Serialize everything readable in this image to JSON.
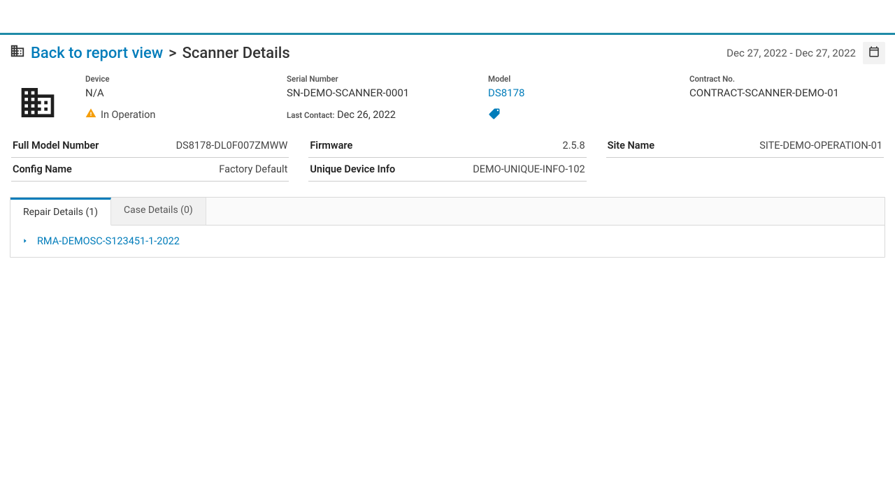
{
  "header": {
    "back_label": "Back to report view",
    "separator": ">",
    "page_title": "Scanner Details",
    "date_range": "Dec 27, 2022 - Dec 27, 2022"
  },
  "summary": {
    "device": {
      "label": "Device",
      "value": "N/A"
    },
    "status_text": "In Operation",
    "serial": {
      "label": "Serial Number",
      "value": "SN-DEMO-SCANNER-0001"
    },
    "last_contact": {
      "label": "Last Contact:",
      "value": "Dec 26, 2022"
    },
    "model": {
      "label": "Model",
      "value": "DS8178"
    },
    "contract": {
      "label": "Contract No.",
      "value": "CONTRACT-SCANNER-DEMO-01"
    }
  },
  "details": {
    "full_model_number": {
      "label": "Full Model Number",
      "value": "DS8178-DL0F007ZMWW"
    },
    "config_name": {
      "label": "Config Name",
      "value": "Factory Default"
    },
    "firmware": {
      "label": "Firmware",
      "value": "2.5.8"
    },
    "unique_device_info": {
      "label": "Unique Device Info",
      "value": "DEMO-UNIQUE-INFO-102"
    },
    "site_name": {
      "label": "Site Name",
      "value": "SITE-DEMO-OPERATION-01"
    }
  },
  "tabs": {
    "repair": {
      "label": "Repair Details (1)",
      "active": true
    },
    "case": {
      "label": "Case Details (0)",
      "active": false
    }
  },
  "rma": {
    "id": "RMA-DEMOSC-S123451-1-2022"
  }
}
